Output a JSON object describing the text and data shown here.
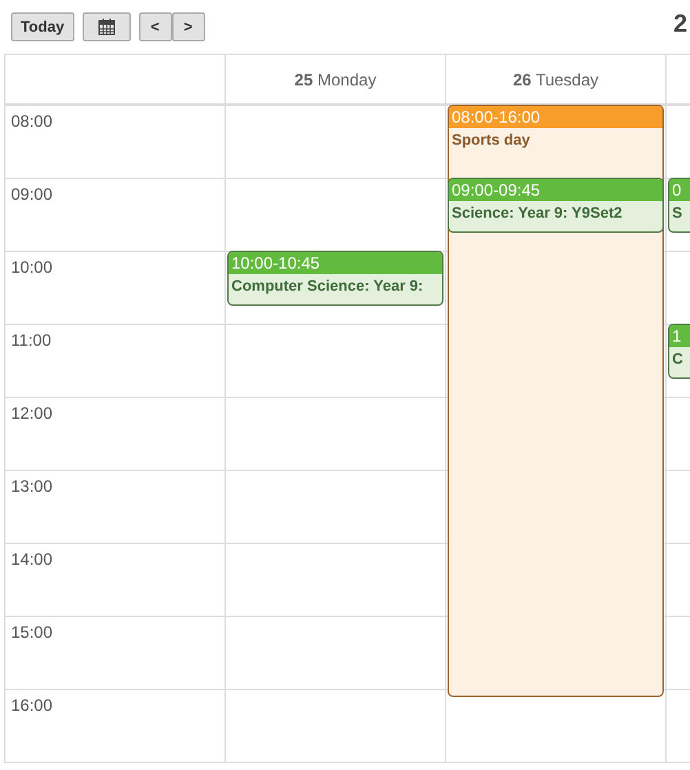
{
  "toolbar": {
    "today_button": "Today",
    "prev_button": "<",
    "next_button": ">",
    "title": "2"
  },
  "columns": [
    {
      "number": "25",
      "day": "Monday",
      "rows": [
        {},
        {},
        {
          "events": [
            {
              "kind": "lesson",
              "time": "10:00-10:45",
              "title": "Computer Science: Year 9:"
            }
          ]
        }
      ]
    },
    {
      "number": "26",
      "day": "Tuesday",
      "rows": [
        {
          "events": [
            {
              "kind": "activity",
              "time": "08:00-16:00",
              "title": "Sports day"
            }
          ]
        },
        {
          "events": [
            {
              "kind": "lesson",
              "time": "09:00-09:45",
              "title": "Science: Year 9: Y9Set2"
            }
          ]
        }
      ]
    },
    {
      "rows": [
        {},
        {
          "events": [
            {
              "kind": "lesson",
              "time": "0",
              "title": "S"
            }
          ]
        },
        {},
        {
          "events": [
            {
              "kind": "lesson",
              "time": "1",
              "title": "C"
            }
          ]
        }
      ]
    }
  ],
  "hours": [
    "08:00",
    "09:00",
    "10:00",
    "11:00",
    "12:00",
    "13:00",
    "14:00",
    "15:00",
    "16:00"
  ]
}
